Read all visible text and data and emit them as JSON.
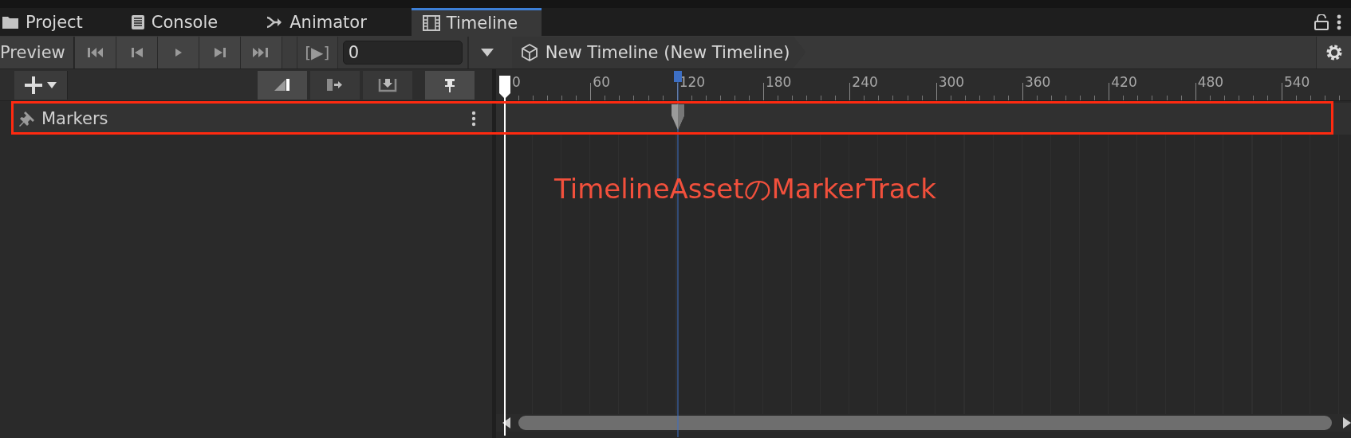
{
  "tabs": [
    {
      "label": "Project",
      "selected": false
    },
    {
      "label": "Console",
      "selected": false
    },
    {
      "label": "Animator",
      "selected": false
    },
    {
      "label": "Timeline",
      "selected": true
    }
  ],
  "toolbar": {
    "preview_button": "Preview",
    "play_range_button": "[▶]",
    "frame_field": {
      "value": "0"
    },
    "breadcrumb": "New Timeline (New Timeline)"
  },
  "track_toolbar": {
    "toggles": [
      {
        "on": true
      },
      {
        "on": false
      },
      {
        "on": false
      },
      {
        "on": true
      }
    ]
  },
  "ruler": {
    "labels": [
      "0",
      "60",
      "120",
      "180",
      "240",
      "300",
      "360",
      "420",
      "480",
      "540"
    ]
  },
  "tracks": [
    {
      "name": "Markers"
    }
  ],
  "annotation": "TimelineAssetのMarkerTrack"
}
